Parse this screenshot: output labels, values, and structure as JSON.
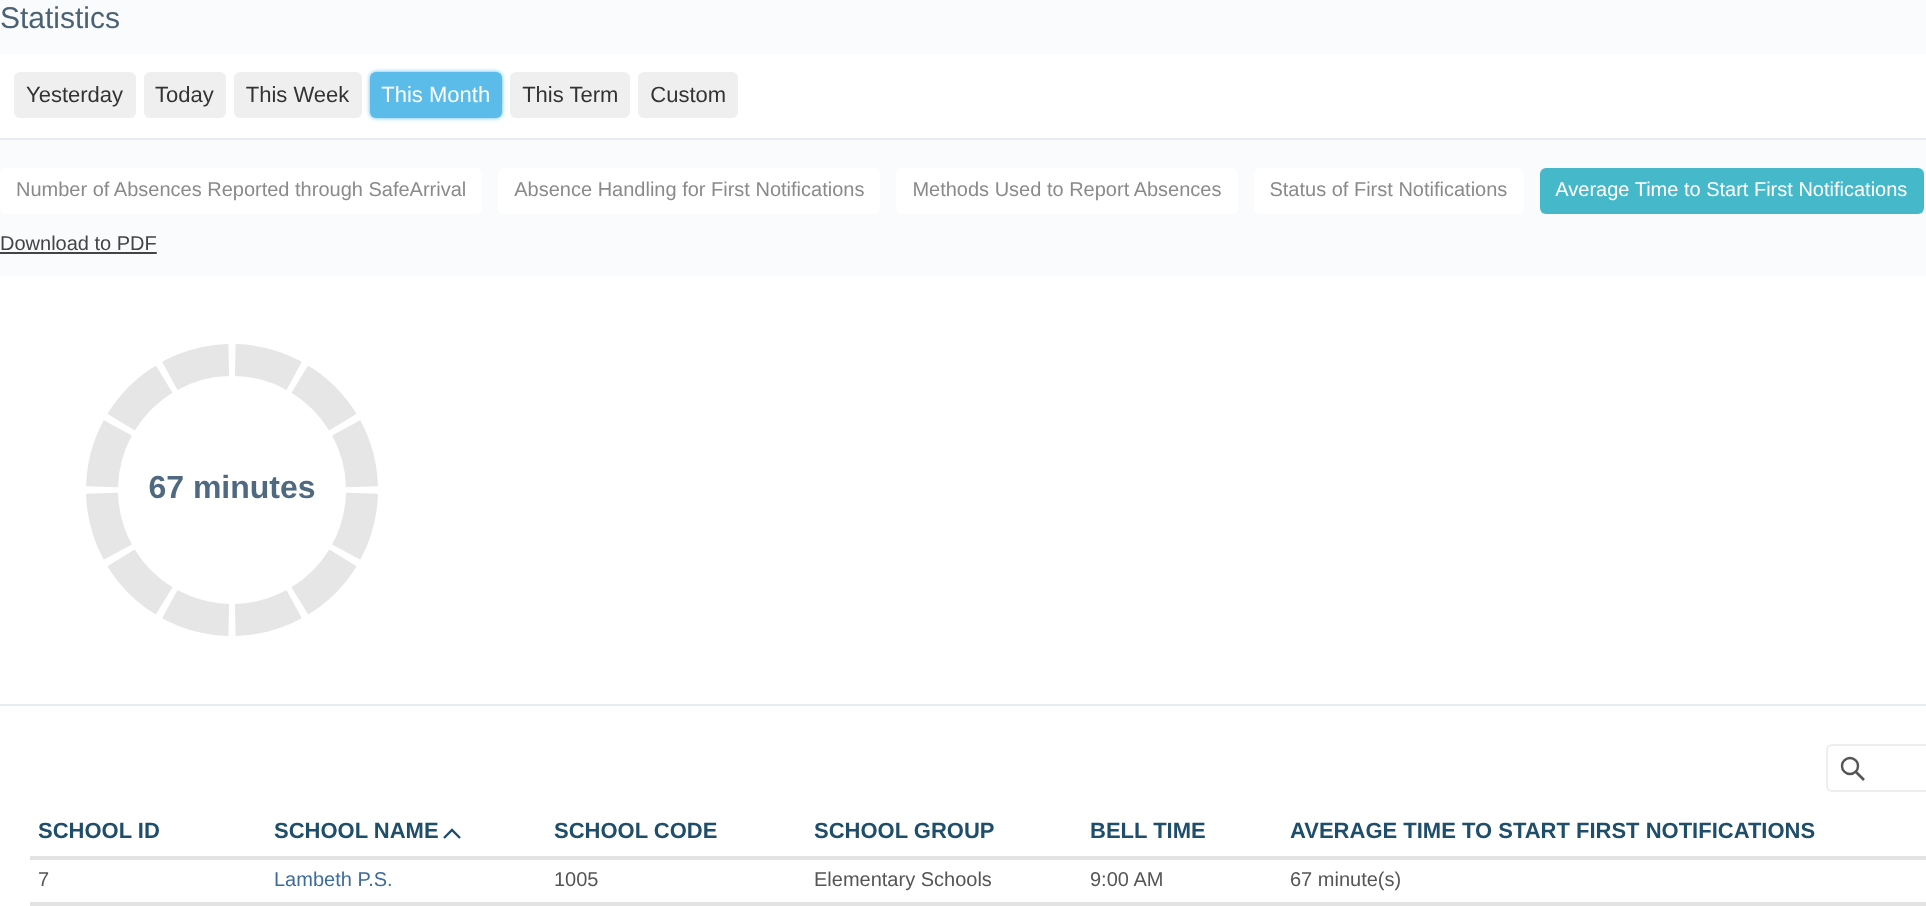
{
  "page": {
    "title": "Statistics"
  },
  "periods": [
    {
      "label": "Yesterday",
      "selected": false
    },
    {
      "label": "Today",
      "selected": false
    },
    {
      "label": "This Week",
      "selected": false
    },
    {
      "label": "This Month",
      "selected": true
    },
    {
      "label": "This Term",
      "selected": false
    },
    {
      "label": "Custom",
      "selected": false
    }
  ],
  "reports": [
    {
      "label": "Number of Absences Reported through SafeArrival",
      "selected": false
    },
    {
      "label": "Absence Handling for First Notifications",
      "selected": false
    },
    {
      "label": "Methods Used to Report Absences",
      "selected": false
    },
    {
      "label": "Status of First Notifications",
      "selected": false
    },
    {
      "label": "Average Time to Start First Notifications",
      "selected": true
    }
  ],
  "download_link": "Download to PDF",
  "donut": {
    "center_text": "67 minutes"
  },
  "table": {
    "columns": [
      {
        "label": "SCHOOL ID",
        "sorted": false
      },
      {
        "label": "SCHOOL NAME",
        "sorted": true
      },
      {
        "label": "SCHOOL CODE",
        "sorted": false
      },
      {
        "label": "SCHOOL GROUP",
        "sorted": false
      },
      {
        "label": "BELL TIME",
        "sorted": false
      },
      {
        "label": "AVERAGE TIME TO START FIRST NOTIFICATIONS",
        "sorted": false
      }
    ],
    "rows": [
      {
        "cells": [
          {
            "text": "7",
            "kind": "text"
          },
          {
            "text": "Lambeth P.S.",
            "kind": "link"
          },
          {
            "text": "1005",
            "kind": "text"
          },
          {
            "text": "Elementary Schools",
            "kind": "text"
          },
          {
            "text": "9:00 AM",
            "kind": "text"
          },
          {
            "text": "67 minute(s)",
            "kind": "text"
          }
        ]
      }
    ]
  }
}
